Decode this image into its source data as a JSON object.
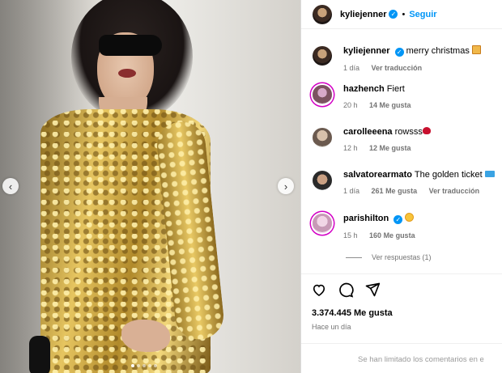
{
  "post": {
    "username": "kyliejenner",
    "follow_label": "Seguir",
    "separator": "•",
    "carousel": {
      "slide_count": 5,
      "active_index": 0
    }
  },
  "caption": {
    "username": "kyliejenner",
    "text": "merry christmas",
    "time": "1 día",
    "translate": "Ver traducción"
  },
  "comments": [
    {
      "username": "hazhench",
      "text": "Fiert",
      "time": "20 h",
      "likes": "14 Me gusta"
    },
    {
      "username": "carolleeena",
      "text": "rowsss",
      "time": "12 h",
      "likes": "12 Me gusta"
    },
    {
      "username": "salvatorearmato",
      "text": "The golden ticket",
      "time": "1 día",
      "likes": "261 Me gusta",
      "translate": "Ver traducción"
    },
    {
      "username": "parishilton",
      "text": "",
      "time": "15 h",
      "likes": "160 Me gusta"
    }
  ],
  "replies_label": "Ver respuestas (1)",
  "likes_total": "3.374.445 Me gusta",
  "posted_time": "Hace un día",
  "comments_limited": "Se han limitado los comentarios en e"
}
